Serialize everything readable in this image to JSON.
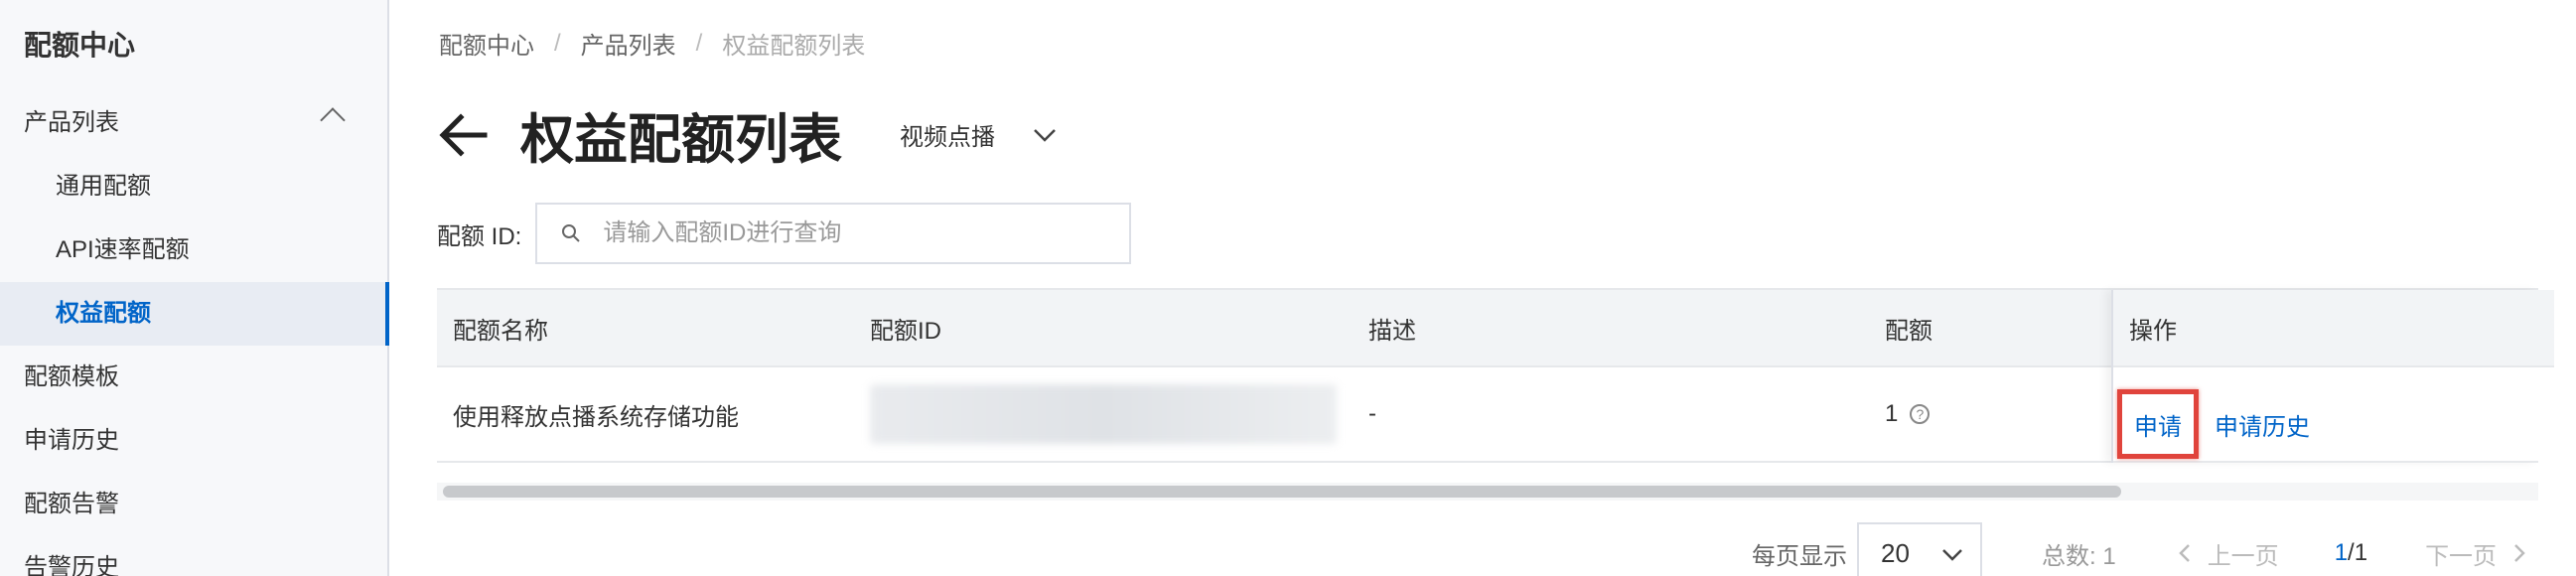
{
  "sidebar": {
    "title": "配额中心",
    "product_list": "产品列表",
    "items": [
      {
        "label": "通用配额"
      },
      {
        "label": "API速率配额"
      },
      {
        "label": "权益配额"
      }
    ],
    "template": "配额模板",
    "apply_history": "申请历史",
    "alarm": "配额告警",
    "alarm_history": "告警历史"
  },
  "breadcrumb": {
    "home": "配额中心",
    "product_list": "产品列表",
    "current": "权益配额列表",
    "separator": "/"
  },
  "header": {
    "title": "权益配额列表",
    "product": "视频点播"
  },
  "search": {
    "label": "配额 ID:",
    "placeholder": "请输入配额ID进行查询"
  },
  "table": {
    "columns": [
      "配额名称",
      "配额ID",
      "描述",
      "配额",
      "操作"
    ],
    "rows": [
      {
        "name": "使用释放点播系统存储功能",
        "id": "",
        "description": "-",
        "quota": "1",
        "actions": [
          "申请",
          "申请历史"
        ]
      }
    ]
  },
  "pagination": {
    "per_page_label": "每页显示",
    "per_page": "20",
    "total": "总数: 1",
    "prev": "上一页",
    "current": "1",
    "total_pages": "/1",
    "next": "下一页"
  },
  "colors": {
    "accent": "#0064c8",
    "highlight": "#e0443c"
  }
}
